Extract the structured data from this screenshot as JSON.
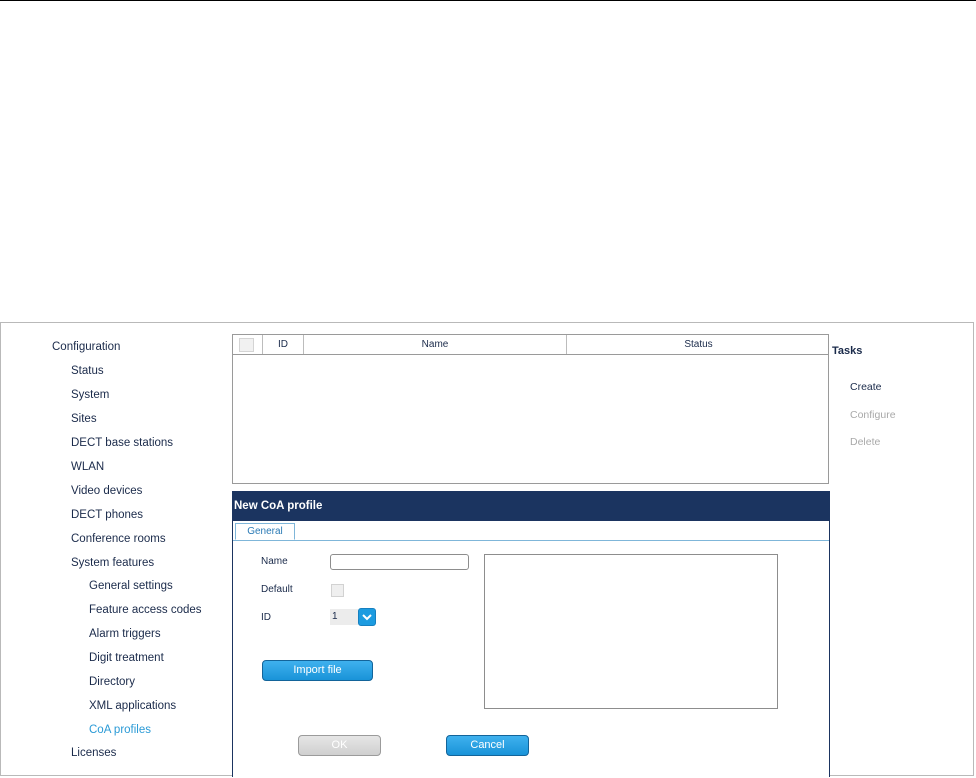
{
  "sidebar": {
    "items": [
      {
        "label": "Configuration"
      },
      {
        "label": "Status"
      },
      {
        "label": "System"
      },
      {
        "label": "Sites"
      },
      {
        "label": "DECT base stations"
      },
      {
        "label": "WLAN"
      },
      {
        "label": "Video devices"
      },
      {
        "label": "DECT phones"
      },
      {
        "label": "Conference rooms"
      },
      {
        "label": "System features"
      },
      {
        "label": "General settings"
      },
      {
        "label": "Feature access codes"
      },
      {
        "label": "Alarm triggers"
      },
      {
        "label": "Digit treatment"
      },
      {
        "label": "Directory"
      },
      {
        "label": "XML applications"
      },
      {
        "label": "CoA profiles"
      },
      {
        "label": "Licenses"
      }
    ]
  },
  "table": {
    "columns": {
      "id": "ID",
      "name": "Name",
      "status": "Status"
    }
  },
  "tasks": {
    "title": "Tasks",
    "create": "Create",
    "configure": "Configure",
    "delete": "Delete"
  },
  "dialog": {
    "title": "New CoA profile",
    "tab_general": "General",
    "name_label": "Name",
    "name_value": "",
    "default_label": "Default",
    "id_label": "ID",
    "id_value": "1",
    "import_label": "Import file",
    "ok_label": "OK",
    "cancel_label": "Cancel"
  },
  "colors": {
    "title_bar": "#1b3460",
    "accent": "#1c9be0",
    "active_nav": "#2a9ad6"
  }
}
